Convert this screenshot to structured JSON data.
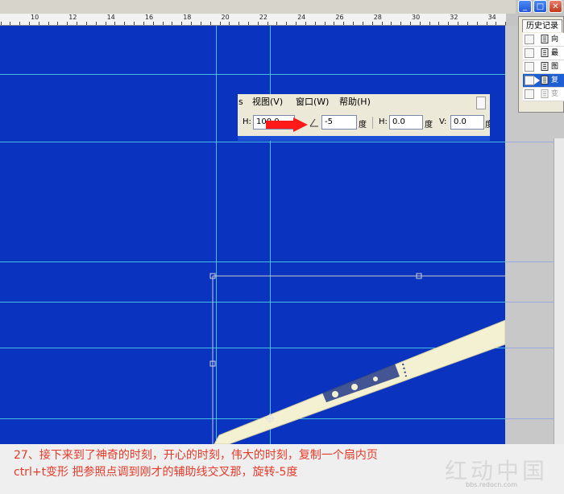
{
  "ruler": {
    "marks": [
      "10",
      "12",
      "14",
      "16",
      "18",
      "20",
      "22",
      "24",
      "26",
      "28",
      "30",
      "32",
      "34"
    ]
  },
  "window_buttons": [
    "_",
    "□",
    "✕"
  ],
  "history_panel": {
    "tab_label": "历史记录",
    "rows": [
      {
        "label": "向"
      },
      {
        "label": "最"
      },
      {
        "label": "图"
      },
      {
        "label": "复",
        "selected": true
      },
      {
        "label": "变",
        "dim": true
      }
    ]
  },
  "menu": {
    "cut_label": "s",
    "items": [
      "视图(V)",
      "窗口(W)",
      "帮助(H)"
    ]
  },
  "options_bar": {
    "h_label": "H:",
    "h_value": "100.0",
    "angle_icon": "angle-icon",
    "angle_value": "-5",
    "angle_unit": "度",
    "skew_h_label": "H:",
    "skew_h_value": "0.0",
    "skew_h_unit": "度",
    "skew_v_label": "V:",
    "skew_v_value": "0.0",
    "skew_v_unit": "度"
  },
  "colors": {
    "canvas": "#0a33c0",
    "guide": "#4fd7e6",
    "caption_text": "#e63a2a",
    "arrow": "#ff1a1a"
  },
  "caption": {
    "line1": "27、接下来到了神奇的时刻，开心的时刻，伟大的时刻，复制一个扇内页",
    "line2": "ctrl+t变形  把参照点调到刚才的辅助线交叉那，旋转-5度"
  },
  "watermark": {
    "text": "红动中国",
    "url": "bbs.redocn.com"
  }
}
